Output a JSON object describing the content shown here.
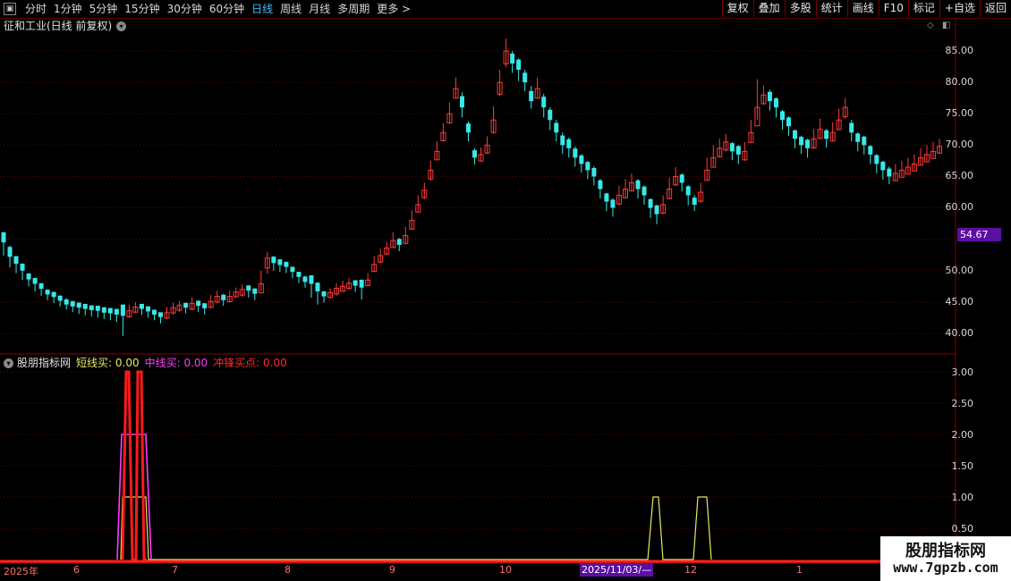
{
  "toolbar": {
    "periods": [
      "分时",
      "1分钟",
      "5分钟",
      "15分钟",
      "30分钟",
      "60分钟",
      "日线",
      "周线",
      "月线",
      "多周期",
      "更多 >"
    ],
    "active_period": "日线",
    "right_buttons": [
      "复权",
      "叠加",
      "多股",
      "统计",
      "画线",
      "F10",
      "标记",
      "+自选",
      "返回"
    ]
  },
  "main": {
    "title": "征和工业(日线 前复权)",
    "yaxis": [
      "85.00",
      "80.00",
      "75.00",
      "70.00",
      "65.00",
      "60.00",
      "50.00",
      "45.00",
      "40.00"
    ],
    "price_tag": "54.67"
  },
  "indicator": {
    "name": "股朋指标网",
    "line1": "短线买: 0.00",
    "line2": "中线买: 0.00",
    "line3": "冲锋买点: 0.00",
    "yaxis": [
      "3.00",
      "2.50",
      "2.00",
      "1.50",
      "1.00",
      "0.50"
    ]
  },
  "xaxis": {
    "labels": [
      "2025年",
      "6",
      "7",
      "8",
      "9",
      "10",
      "12",
      "1"
    ],
    "cursor": "2025/11/03/—"
  },
  "watermark": {
    "title": "股朋指标网",
    "url": "www.7gpzb.com"
  },
  "colors": {
    "up": "#ff3a3a",
    "down": "#38e8e8",
    "short_buy": "#e8e860",
    "mid_buy": "#ff3bff",
    "charge_buy": "#ff1a1a"
  },
  "chart_data": [
    {
      "type": "candlestick",
      "ylim": [
        37.5,
        87.5
      ],
      "close": [
        54.5,
        52.2,
        51.1,
        50.0,
        48.6,
        47.9,
        47.1,
        46.2,
        45.8,
        45.2,
        44.6,
        44.3,
        44.1,
        43.9,
        43.7,
        43.6,
        43.3,
        43.2,
        43.0,
        42.8,
        43.6,
        44.2,
        43.9,
        43.5,
        43.0,
        42.6,
        43.3,
        44.1,
        44.5,
        44.1,
        44.8,
        44.4,
        44.0,
        45.1,
        45.9,
        45.3,
        45.9,
        46.6,
        47.0,
        46.8,
        46.3,
        47.9,
        52.0,
        51.2,
        50.9,
        50.6,
        49.8,
        49.0,
        48.2,
        47.9,
        46.7,
        45.9,
        46.5,
        47.2,
        47.5,
        48.0,
        47.6,
        47.3,
        48.5,
        51.0,
        52.4,
        53.6,
        54.8,
        54.1,
        55.6,
        58.0,
        60.5,
        62.8,
        66.0,
        69.0,
        72.0,
        75.0,
        79.0,
        76.0,
        72.0,
        68.0,
        68.5,
        70.0,
        74.0,
        80.0,
        85.0,
        83.0,
        82.0,
        80.0,
        77.0,
        79.0,
        76.0,
        74.0,
        72.0,
        70.0,
        69.5,
        68.0,
        67.0,
        66.0,
        65.0,
        63.0,
        61.0,
        60.0,
        62.0,
        63.0,
        64.0,
        63.0,
        62.0,
        60.0,
        59.0,
        60.5,
        63.0,
        65.0,
        64.0,
        62.0,
        60.5,
        62.5,
        66.0,
        68.0,
        69.5,
        70.5,
        69.0,
        68.5,
        69.0,
        72.0,
        76.0,
        78.0,
        77.0,
        76.0,
        74.0,
        73.0,
        71.0,
        70.0,
        69.5,
        71.0,
        72.5,
        71.0,
        72.0,
        74.0,
        76.0,
        72.0,
        70.5,
        70.0,
        68.5,
        67.0,
        66.0,
        65.0,
        65.5,
        66.0,
        66.5,
        67.0,
        68.0,
        68.5,
        69.0,
        69.8
      ],
      "high": [
        56.0,
        54.0,
        52.3,
        51.0,
        49.6,
        48.8,
        48.0,
        47.0,
        46.6,
        46.1,
        45.6,
        45.2,
        44.9,
        44.7,
        44.4,
        44.3,
        44.2,
        44.0,
        43.8,
        43.6,
        44.6,
        45.0,
        44.7,
        44.3,
        43.8,
        43.3,
        44.2,
        44.9,
        45.2,
        44.9,
        45.8,
        45.2,
        44.8,
        46.1,
        46.8,
        46.3,
        46.8,
        47.3,
        47.8,
        47.6,
        47.2,
        50.0,
        53.0,
        52.3,
        51.8,
        51.4,
        50.6,
        49.8,
        49.2,
        48.7,
        47.7,
        46.7,
        47.2,
        48.0,
        48.4,
        48.8,
        48.5,
        48.2,
        49.6,
        52.3,
        53.5,
        54.6,
        56.1,
        55.2,
        57.0,
        59.6,
        62.0,
        64.0,
        67.5,
        70.6,
        73.5,
        76.8,
        80.8,
        78.4,
        73.8,
        69.5,
        69.6,
        71.4,
        76.2,
        82.0,
        87.0,
        85.0,
        83.8,
        82.0,
        79.4,
        80.8,
        78.2,
        76.0,
        74.0,
        72.0,
        71.2,
        69.8,
        68.6,
        67.5,
        66.6,
        64.6,
        62.4,
        61.5,
        63.5,
        64.6,
        65.5,
        64.6,
        63.6,
        61.5,
        60.5,
        62.0,
        64.8,
        66.5,
        65.5,
        63.6,
        62.0,
        64.0,
        68.0,
        70.0,
        71.0,
        71.8,
        70.5,
        70.0,
        70.5,
        74.0,
        80.5,
        79.5,
        78.8,
        77.6,
        75.6,
        74.6,
        72.5,
        71.5,
        71.0,
        72.6,
        74.2,
        72.6,
        73.6,
        75.8,
        77.5,
        74.0,
        72.0,
        71.5,
        70.0,
        68.6,
        67.5,
        66.6,
        67.0,
        67.5,
        68.0,
        68.5,
        69.5,
        70.0,
        70.5,
        71.0
      ],
      "low": [
        52.4,
        50.5,
        49.6,
        48.5,
        47.5,
        46.7,
        46.0,
        45.3,
        44.8,
        44.3,
        43.8,
        43.4,
        43.1,
        42.9,
        42.7,
        42.5,
        42.3,
        42.1,
        41.8,
        39.6,
        42.5,
        43.2,
        42.9,
        42.5,
        42.1,
        41.6,
        42.3,
        43.0,
        43.4,
        43.2,
        43.7,
        43.4,
        43.0,
        44.0,
        44.8,
        44.4,
        44.9,
        45.6,
        45.8,
        45.7,
        45.3,
        46.8,
        49.5,
        50.0,
        49.8,
        49.6,
        48.8,
        48.0,
        47.3,
        45.7,
        44.6,
        44.9,
        45.5,
        46.0,
        46.6,
        47.0,
        46.6,
        45.4,
        47.6,
        49.8,
        51.2,
        52.5,
        53.6,
        53.1,
        54.2,
        56.5,
        59.4,
        61.4,
        64.4,
        67.6,
        70.6,
        73.5,
        77.4,
        74.4,
        70.6,
        66.9,
        67.3,
        68.6,
        71.8,
        77.8,
        82.4,
        81.5,
        80.2,
        78.6,
        75.8,
        77.4,
        74.4,
        72.4,
        70.6,
        68.6,
        68.0,
        66.6,
        65.6,
        64.6,
        63.6,
        61.5,
        59.5,
        58.6,
        60.4,
        61.5,
        62.6,
        61.5,
        60.5,
        58.4,
        57.4,
        59.0,
        61.4,
        63.5,
        62.6,
        60.4,
        59.5,
        60.8,
        64.4,
        66.6,
        68.0,
        69.0,
        67.6,
        67.0,
        67.5,
        70.5,
        74.0,
        76.4,
        75.5,
        74.4,
        72.5,
        71.5,
        69.5,
        68.6,
        68.0,
        69.4,
        71.0,
        69.6,
        70.6,
        72.4,
        74.2,
        70.6,
        69.0,
        68.5,
        67.0,
        65.5,
        64.5,
        63.8,
        64.4,
        65.0,
        65.5,
        66.0,
        66.8,
        67.4,
        68.0,
        68.6
      ],
      "up": [
        false,
        false,
        false,
        false,
        false,
        false,
        false,
        false,
        false,
        false,
        false,
        false,
        false,
        false,
        false,
        false,
        false,
        false,
        false,
        false,
        true,
        true,
        false,
        false,
        false,
        false,
        true,
        true,
        true,
        false,
        true,
        false,
        false,
        true,
        true,
        false,
        true,
        true,
        true,
        false,
        false,
        true,
        true,
        false,
        false,
        false,
        false,
        false,
        false,
        false,
        false,
        false,
        true,
        true,
        true,
        true,
        false,
        false,
        true,
        true,
        true,
        true,
        true,
        false,
        true,
        true,
        true,
        true,
        true,
        true,
        true,
        true,
        true,
        false,
        false,
        false,
        true,
        true,
        true,
        true,
        true,
        false,
        false,
        false,
        false,
        true,
        false,
        false,
        false,
        false,
        false,
        false,
        false,
        false,
        false,
        false,
        false,
        false,
        true,
        true,
        true,
        false,
        false,
        false,
        false,
        true,
        true,
        true,
        false,
        false,
        false,
        true,
        true,
        true,
        true,
        true,
        false,
        false,
        true,
        true,
        true,
        true,
        false,
        false,
        false,
        false,
        false,
        false,
        false,
        true,
        true,
        false,
        true,
        true,
        true,
        false,
        false,
        false,
        false,
        false,
        false,
        false,
        true,
        true,
        true,
        true,
        true,
        true,
        true,
        true
      ]
    },
    {
      "type": "line",
      "ylim": [
        0,
        3.2
      ],
      "series": [
        {
          "name": "短线买",
          "x": [
            135,
            137,
            163,
            166,
            724,
            730,
            736,
            741,
            775,
            780,
            790,
            795
          ],
          "values": [
            0,
            1,
            1,
            0,
            0,
            1,
            1,
            0,
            0,
            1,
            1,
            0
          ]
        },
        {
          "name": "中线买",
          "x": [
            131,
            136,
            163,
            169
          ],
          "values": [
            0,
            2,
            2,
            0
          ]
        },
        {
          "name": "冲锋买点",
          "x": [
            137,
            141,
            144,
            148,
            152,
            154,
            158,
            161,
            164
          ],
          "values": [
            0,
            3,
            3,
            0,
            0,
            3,
            3,
            0,
            0
          ]
        }
      ]
    }
  ]
}
